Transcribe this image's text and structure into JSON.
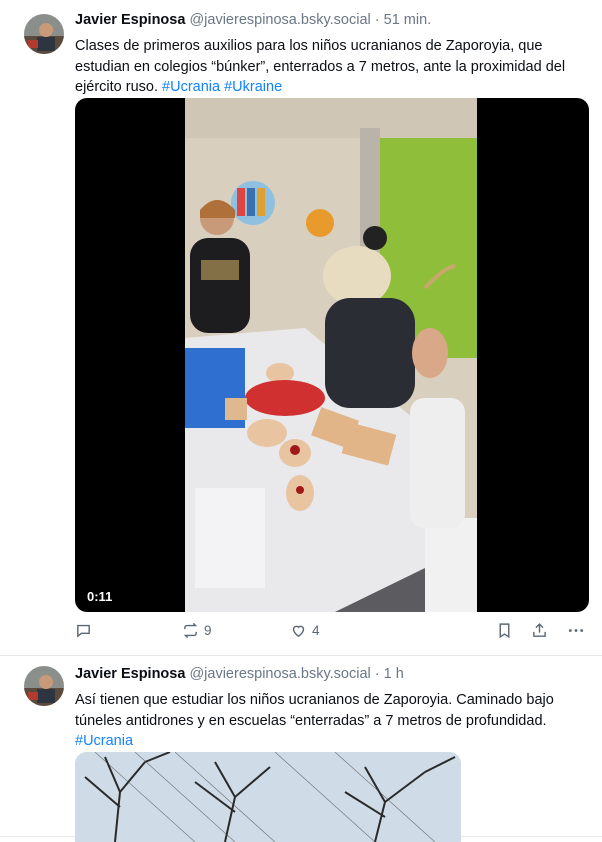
{
  "posts": [
    {
      "author": "Javier Espinosa",
      "handle": "@javierespinosa.bsky.social",
      "separator": "·",
      "time": "51 min.",
      "text": "Clases de primeros auxilios para los niños ucranianos de Zaporoyia, que estudian en colegios “búnker”, enterrados a 7 metros, ante la proximidad del ejército ruso.",
      "tags": [
        "#Ucrania",
        "#Ukraine"
      ],
      "video": {
        "duration": "0:11"
      },
      "actions": {
        "reply_icon": "reply-icon",
        "repost_count": "9",
        "like_count": "4"
      }
    },
    {
      "author": "Javier Espinosa",
      "handle": "@javierespinosa.bsky.social",
      "separator": "·",
      "time": "1 h",
      "text": "Así tienen que estudiar los niños ucranianos de Zaporoyia. Caminado bajo túneles antidrones y en escuelas “enterradas” a 7 metros de profundidad.",
      "tags": [
        "#Ucrania"
      ]
    }
  ],
  "colors": {
    "link": "#1083fe",
    "muted": "#6b7785",
    "action": "#5b6773"
  }
}
